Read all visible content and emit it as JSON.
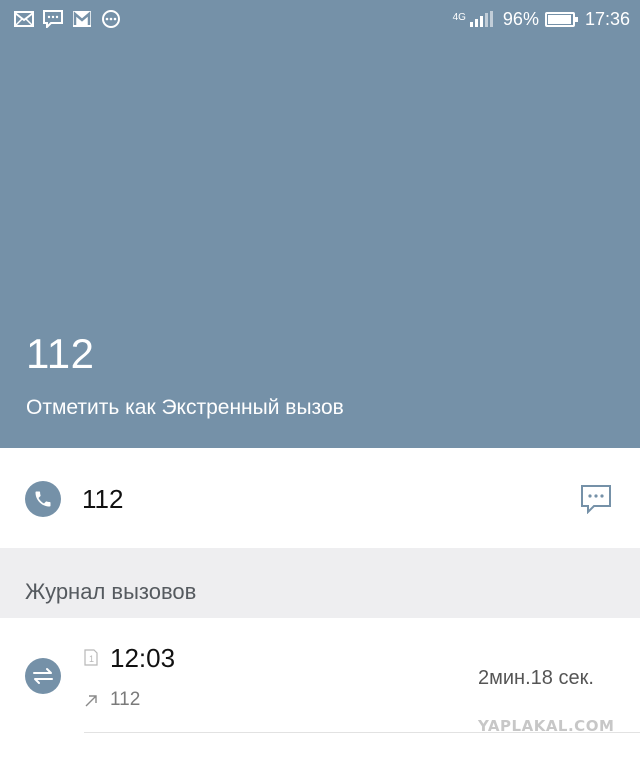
{
  "status_bar": {
    "network": "4G",
    "battery_percent": "96%",
    "battery_level": 0.96,
    "time": "17:36",
    "notification_icons": [
      "mail-icon",
      "chat-icon",
      "gmail-icon",
      "more-icon"
    ]
  },
  "contact": {
    "number": "112",
    "mark_label": "Отметить как Экстренный вызов"
  },
  "call_row": {
    "number": "112",
    "left_icon": "phone-icon",
    "right_icon": "message-icon"
  },
  "call_log": {
    "title": "Журнал вызовов",
    "entries": [
      {
        "sim": "1",
        "time": "12:03",
        "direction": "outgoing",
        "number": "112",
        "duration": "2мин.18 сек."
      }
    ]
  },
  "watermark": "YAPLAKAL.COM",
  "colors": {
    "header": "#7591a8",
    "section_bg": "#eeeef0"
  }
}
